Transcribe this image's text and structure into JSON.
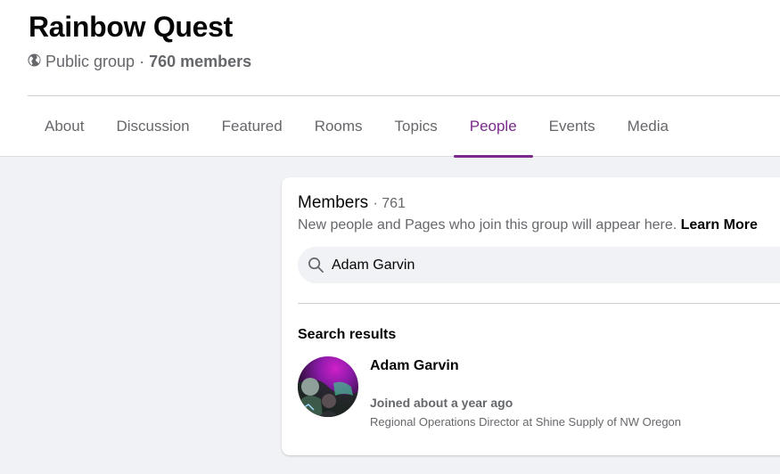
{
  "group": {
    "name": "Rainbow Quest",
    "privacy": "Public group",
    "separator": "·",
    "member_count": "760 members"
  },
  "tabs": [
    {
      "label": "About"
    },
    {
      "label": "Discussion"
    },
    {
      "label": "Featured"
    },
    {
      "label": "Rooms"
    },
    {
      "label": "Topics"
    },
    {
      "label": "People",
      "active": true
    },
    {
      "label": "Events"
    },
    {
      "label": "Media"
    }
  ],
  "members": {
    "title": "Members",
    "count": "· 761",
    "description": "New people and Pages who join this group will appear here.",
    "learn_more": "Learn More"
  },
  "search": {
    "value": "Adam Garvin",
    "icon": "search-icon"
  },
  "results": {
    "title": "Search results",
    "items": [
      {
        "name": "Adam Garvin",
        "joined": "Joined about a year ago",
        "job": "Regional Operations Director at Shine Supply of NW Oregon"
      }
    ]
  },
  "colors": {
    "accent": "#7b2a8b",
    "secondary_text": "#65676b",
    "page_bg": "#f0f2f5"
  }
}
